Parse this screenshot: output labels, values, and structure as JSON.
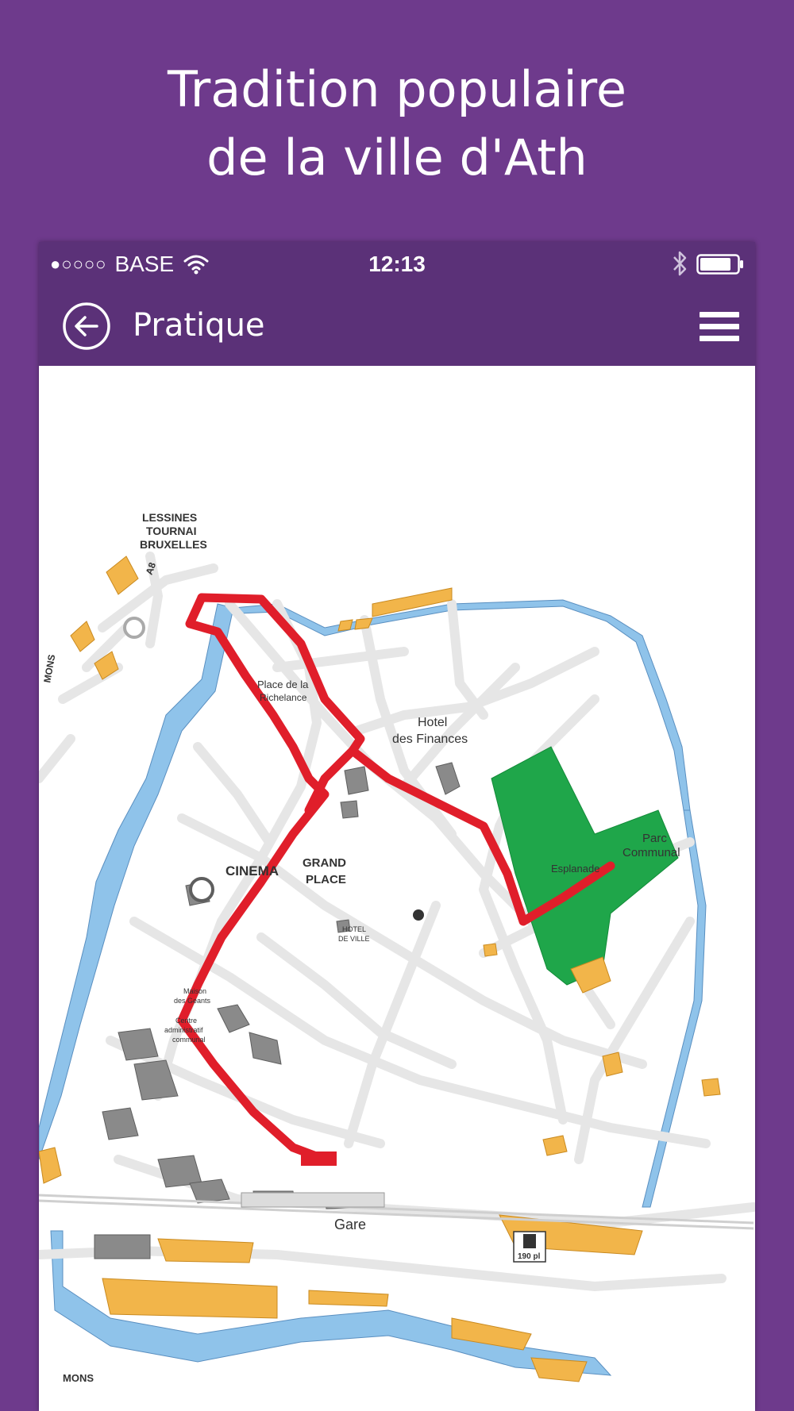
{
  "headline": {
    "line1": "Tradition populaire",
    "line2": "de la ville d'Ath"
  },
  "status_bar": {
    "signal_dots": "●○○○○",
    "carrier": "BASE",
    "time": "12:13",
    "icons": [
      "wifi-icon",
      "bluetooth-icon",
      "battery-icon"
    ]
  },
  "nav_bar": {
    "title": "Pratique",
    "back_icon": "back-arrow-icon",
    "menu_icon": "hamburger-menu-icon"
  },
  "map": {
    "labels": {
      "lessines": "LESSINES",
      "tournai": "TOURNAI",
      "bruxelles": "BRUXELLES",
      "road_a8": "A8",
      "place_richeliance_1": "Place de la",
      "place_richeliance_2": "Richelance",
      "hotel_finances_1": "Hotel",
      "hotel_finances_2": "des Finances",
      "cinema": "CINEMA",
      "grand_place_1": "GRAND",
      "grand_place_2": "PLACE",
      "hotel_ville_1": "HOTEL",
      "hotel_ville_2": "DE VILLE",
      "parc_1": "Parc",
      "parc_2": "Communal",
      "esplanade": "Esplanade",
      "maison_1": "Maison",
      "maison_2": "des Geants",
      "centre_1": "Centre",
      "centre_2": "administratif",
      "centre_3": "communal",
      "gare": "Gare",
      "parking": "P",
      "parking_places": "190 pl",
      "mons": "MONS",
      "mons_side": "MONS"
    },
    "colors": {
      "route": "#e01e2a",
      "water": "#8fc3ea",
      "park": "#1fa64a",
      "buildings": "#f2b54a",
      "landmarks": "#8a8a8a",
      "roads": "#e6e6e6"
    }
  }
}
